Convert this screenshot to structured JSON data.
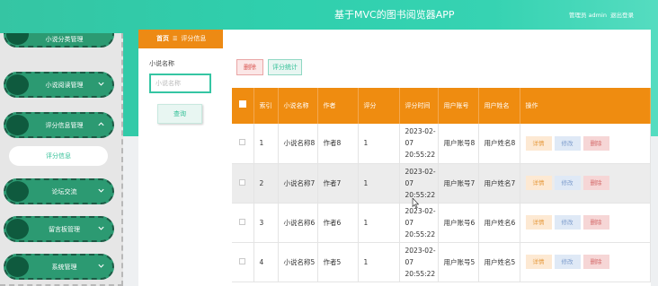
{
  "header": {
    "app_title": "基于MVC的图书阅览器APP",
    "admin_label": "管理员 admin",
    "logout_label": "退出登录"
  },
  "sidebar": {
    "items": [
      {
        "label": "小说分类管理"
      },
      {
        "label": "小说阅读管理"
      },
      {
        "label": "评分信息管理"
      },
      {
        "label": "论坛交流"
      },
      {
        "label": "留言板管理"
      },
      {
        "label": "系统管理"
      }
    ],
    "submenu_label": "评分信息"
  },
  "breadcrumb": {
    "home": "首页",
    "separator_icon": "menu-icon",
    "current": "评分信息"
  },
  "search": {
    "label": "小说名称",
    "placeholder": "小说名称",
    "button": "查询"
  },
  "toolbar": {
    "delete_label": "删除",
    "stats_label": "评分统计"
  },
  "table": {
    "headers": [
      "索引",
      "小说名称",
      "作者",
      "评分",
      "评分时间",
      "用户账号",
      "用户姓名",
      "操作"
    ],
    "rows": [
      {
        "index": "1",
        "name": "小说名称8",
        "author": "作者8",
        "score": "1",
        "time": "2023-02-07 20:55:22",
        "account": "用户账号8",
        "username": "用户姓名8"
      },
      {
        "index": "2",
        "name": "小说名称7",
        "author": "作者7",
        "score": "1",
        "time": "2023-02-07 20:55:22",
        "account": "用户账号7",
        "username": "用户姓名7"
      },
      {
        "index": "3",
        "name": "小说名称6",
        "author": "作者6",
        "score": "1",
        "time": "2023-02-07 20:55:22",
        "account": "用户账号6",
        "username": "用户姓名6"
      },
      {
        "index": "4",
        "name": "小说名称5",
        "author": "作者5",
        "score": "1",
        "time": "2023-02-07 20:55:22",
        "account": "用户账号5",
        "username": "用户姓名5"
      }
    ],
    "actions": {
      "detail": "详情",
      "edit": "修改",
      "delete": "删除"
    }
  },
  "colors": {
    "header_teal": "#35c5a3",
    "table_header_orange": "#ef8c10",
    "menu_green": "#2c9a72"
  }
}
